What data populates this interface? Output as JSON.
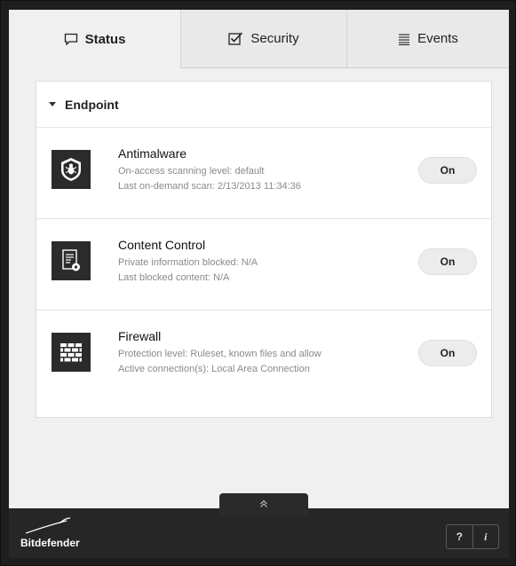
{
  "tabs": [
    {
      "label": "Status",
      "icon": "speech-bubble-icon",
      "active": true
    },
    {
      "label": "Security",
      "icon": "checkbox-icon",
      "active": false
    },
    {
      "label": "Events",
      "icon": "lines-icon",
      "active": false
    }
  ],
  "panel": {
    "section_title": "Endpoint",
    "modules": [
      {
        "title": "Antimalware",
        "line1": "On-access scanning level: default",
        "line2": "Last on-demand scan: 2/13/2013 11:34:36",
        "toggle": "On",
        "icon": "shield-bug-icon"
      },
      {
        "title": "Content Control",
        "line1": "Private information blocked: N/A",
        "line2": "Last blocked content: N/A",
        "toggle": "On",
        "icon": "document-gear-icon"
      },
      {
        "title": "Firewall",
        "line1": "Protection level: Ruleset, known files and allow",
        "line2": "Active connection(s): Local Area Connection",
        "toggle": "On",
        "icon": "brick-wall-icon"
      }
    ]
  },
  "footer": {
    "brand": "Bitdefender",
    "help_label": "?",
    "info_label": "i",
    "expand_icon": "double-chevron-up-icon"
  },
  "colors": {
    "frame": "#1e1e1e",
    "tab_bg": "#e9e9e9",
    "icon_bg": "#2b2b2b",
    "toggle_bg": "#ececec"
  }
}
